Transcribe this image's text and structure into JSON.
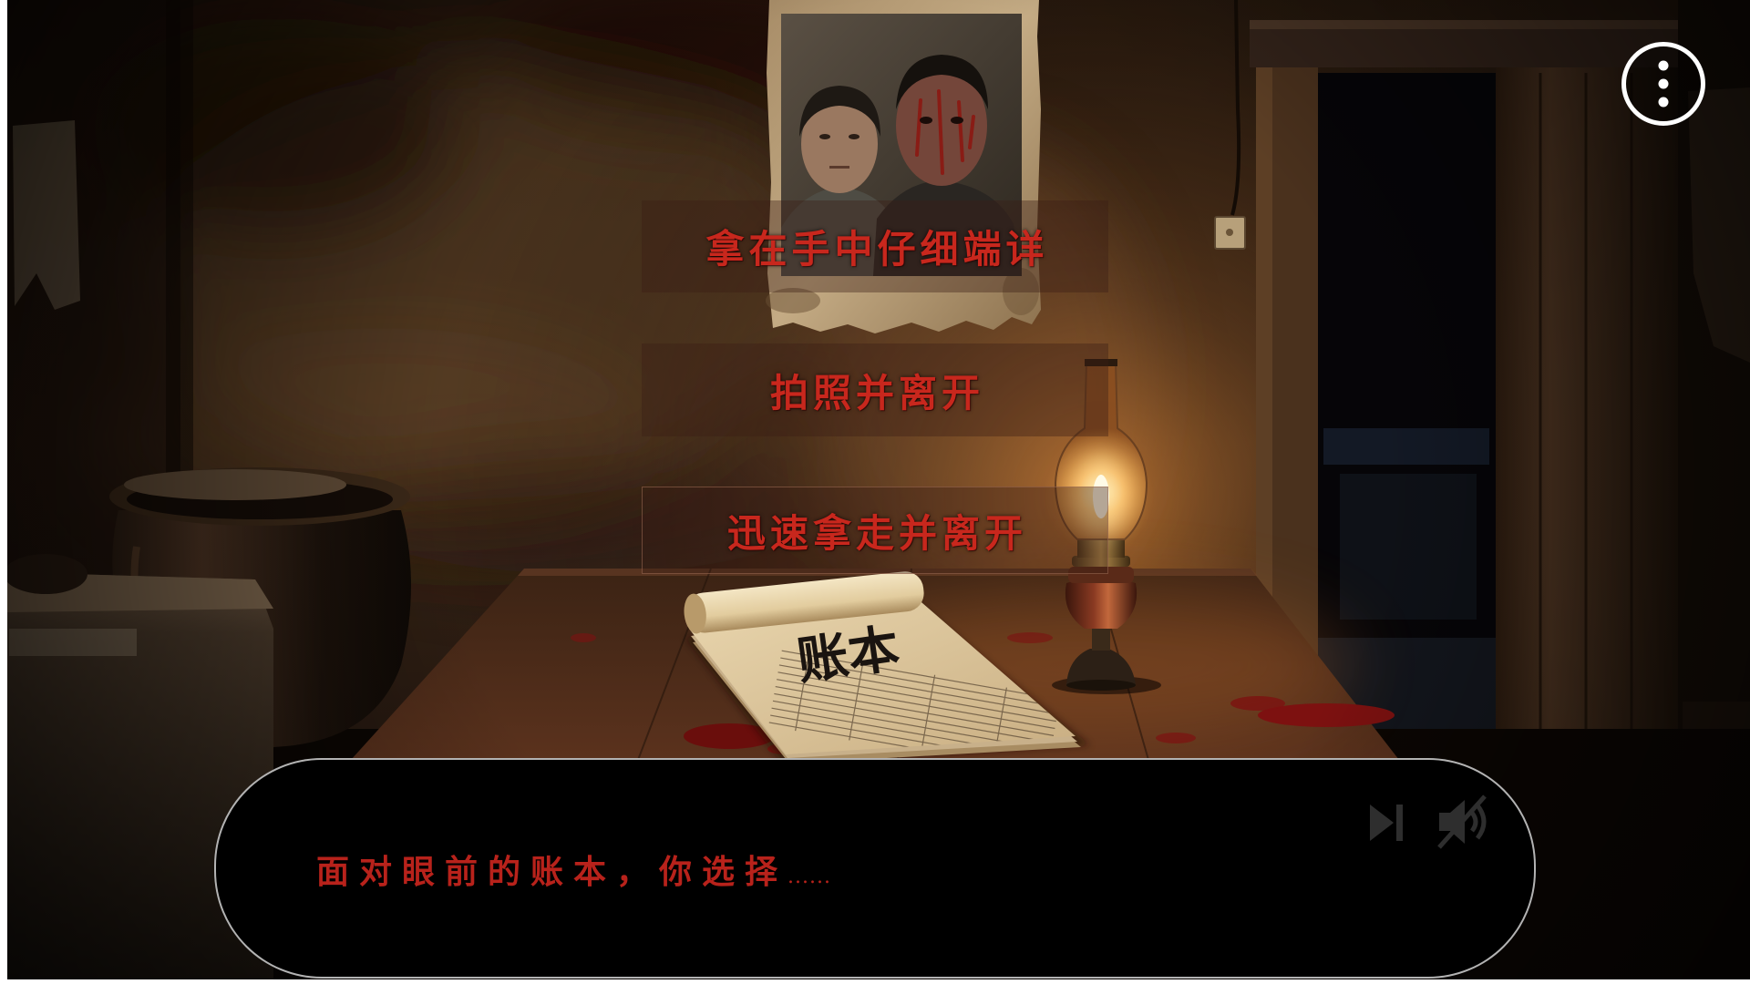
{
  "menu": {
    "icon": "more-vertical-icon"
  },
  "choices": [
    {
      "label": "拿在手中仔细端详"
    },
    {
      "label": "拍照并离开"
    },
    {
      "label": "迅速拿走并离开"
    }
  ],
  "dialog": {
    "text": "面对眼前的账本，你选择",
    "ellipsis": "......",
    "skip_icon": "skip-forward-icon",
    "mute_icon": "volume-muted-icon"
  },
  "scene": {
    "ledger_title": "账本"
  },
  "colors": {
    "choice_text": "#c8271d",
    "dialog_text": "#b8221b",
    "dialog_background": "#000000",
    "menu_icon": "#ffffff",
    "dialog_icons": "#2e2e2e"
  }
}
